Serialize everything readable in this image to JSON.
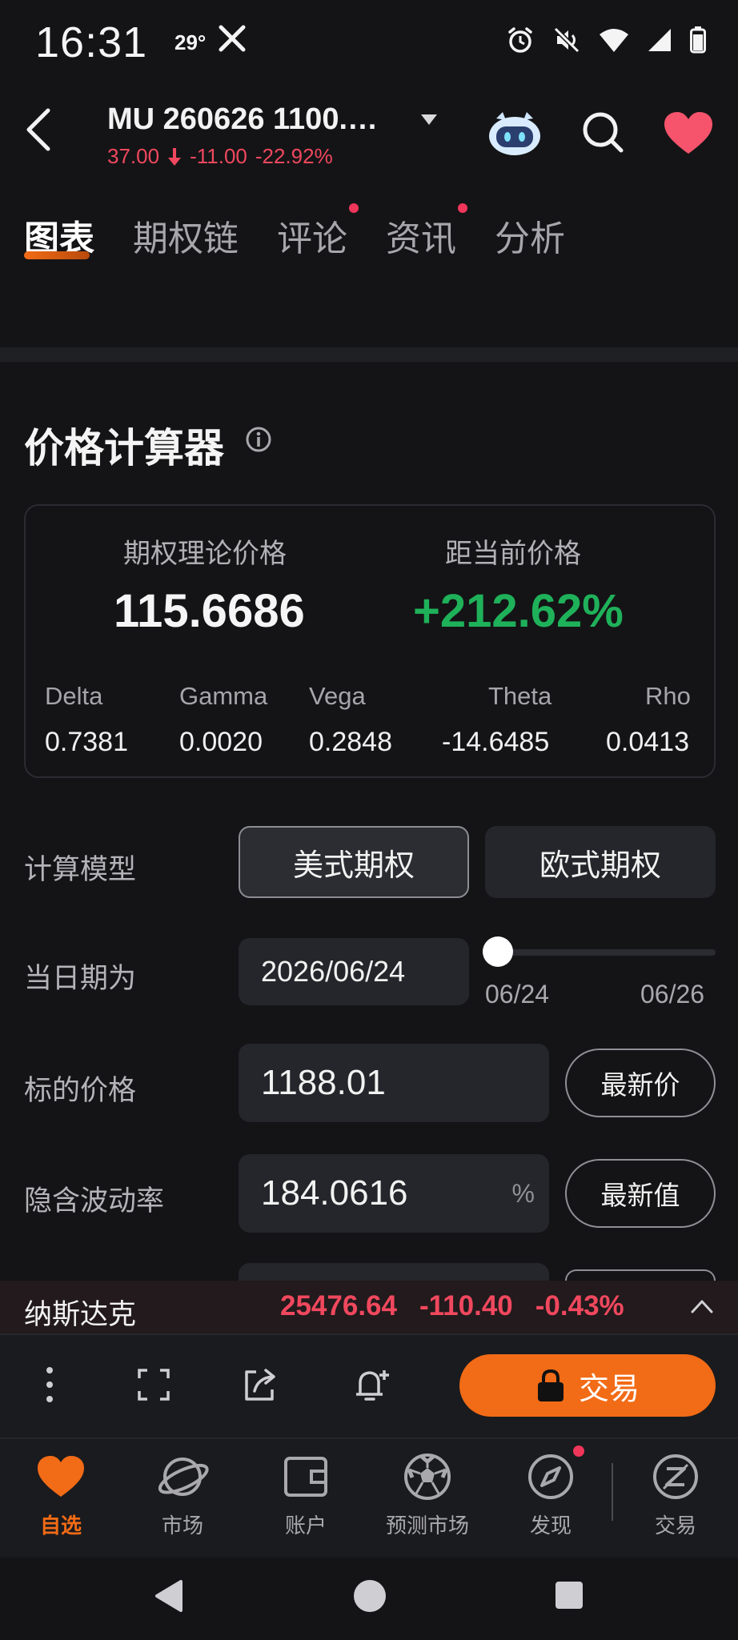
{
  "status_bar": {
    "time": "16:31",
    "temperature": "29°"
  },
  "header": {
    "title": "MU 260626 1100.…",
    "price": "37.00",
    "change": "-11.00",
    "change_pct": "-22.92%"
  },
  "tabs": [
    {
      "label": "图表",
      "active": true,
      "dot": false
    },
    {
      "label": "期权链",
      "active": false,
      "dot": false
    },
    {
      "label": "评论",
      "active": false,
      "dot": true
    },
    {
      "label": "资讯",
      "active": false,
      "dot": true
    },
    {
      "label": "分析",
      "active": false,
      "dot": false
    }
  ],
  "calculator": {
    "title": "价格计算器",
    "theoretical_label": "期权理论价格",
    "theoretical_value": "115.6686",
    "distance_label": "距当前价格",
    "distance_value": "+212.62%",
    "greeks": [
      {
        "label": "Delta",
        "value": "0.7381"
      },
      {
        "label": "Gamma",
        "value": "0.0020"
      },
      {
        "label": "Vega",
        "value": "0.2848"
      },
      {
        "label": "Theta",
        "value": "-14.6485"
      },
      {
        "label": "Rho",
        "value": "0.0413"
      }
    ],
    "model_label": "计算模型",
    "model_american": "美式期权",
    "model_european": "欧式期权",
    "date_label": "当日期为",
    "date_value": "2026/06/24",
    "slider_start": "06/24",
    "slider_end": "06/26",
    "slider_position": 0,
    "underlying_label": "标的价格",
    "underlying_value": "1188.01",
    "latest_price_btn": "最新价",
    "iv_label": "隐含波动率",
    "iv_value": "184.0616",
    "iv_unit": "%",
    "latest_value_btn": "最新值"
  },
  "ticker": {
    "name": "纳斯达克",
    "value": "25476.64",
    "change": "-110.40",
    "change_pct": "-0.43%"
  },
  "toolbar": {
    "trade_label": "交易"
  },
  "bottom_nav": [
    {
      "label": "自选",
      "icon": "heart-icon",
      "active": true
    },
    {
      "label": "市场",
      "icon": "planet-icon",
      "active": false
    },
    {
      "label": "账户",
      "icon": "wallet-icon",
      "active": false
    },
    {
      "label": "预测市场",
      "icon": "soccer-ball-icon",
      "active": false
    },
    {
      "label": "发现",
      "icon": "compass-icon",
      "active": false
    },
    {
      "label": "交易",
      "icon": "trade-icon",
      "active": false
    }
  ],
  "colors": {
    "accent": "#f26b16",
    "down": "#f0485e",
    "up": "#1fb15a",
    "background": "#141416"
  }
}
